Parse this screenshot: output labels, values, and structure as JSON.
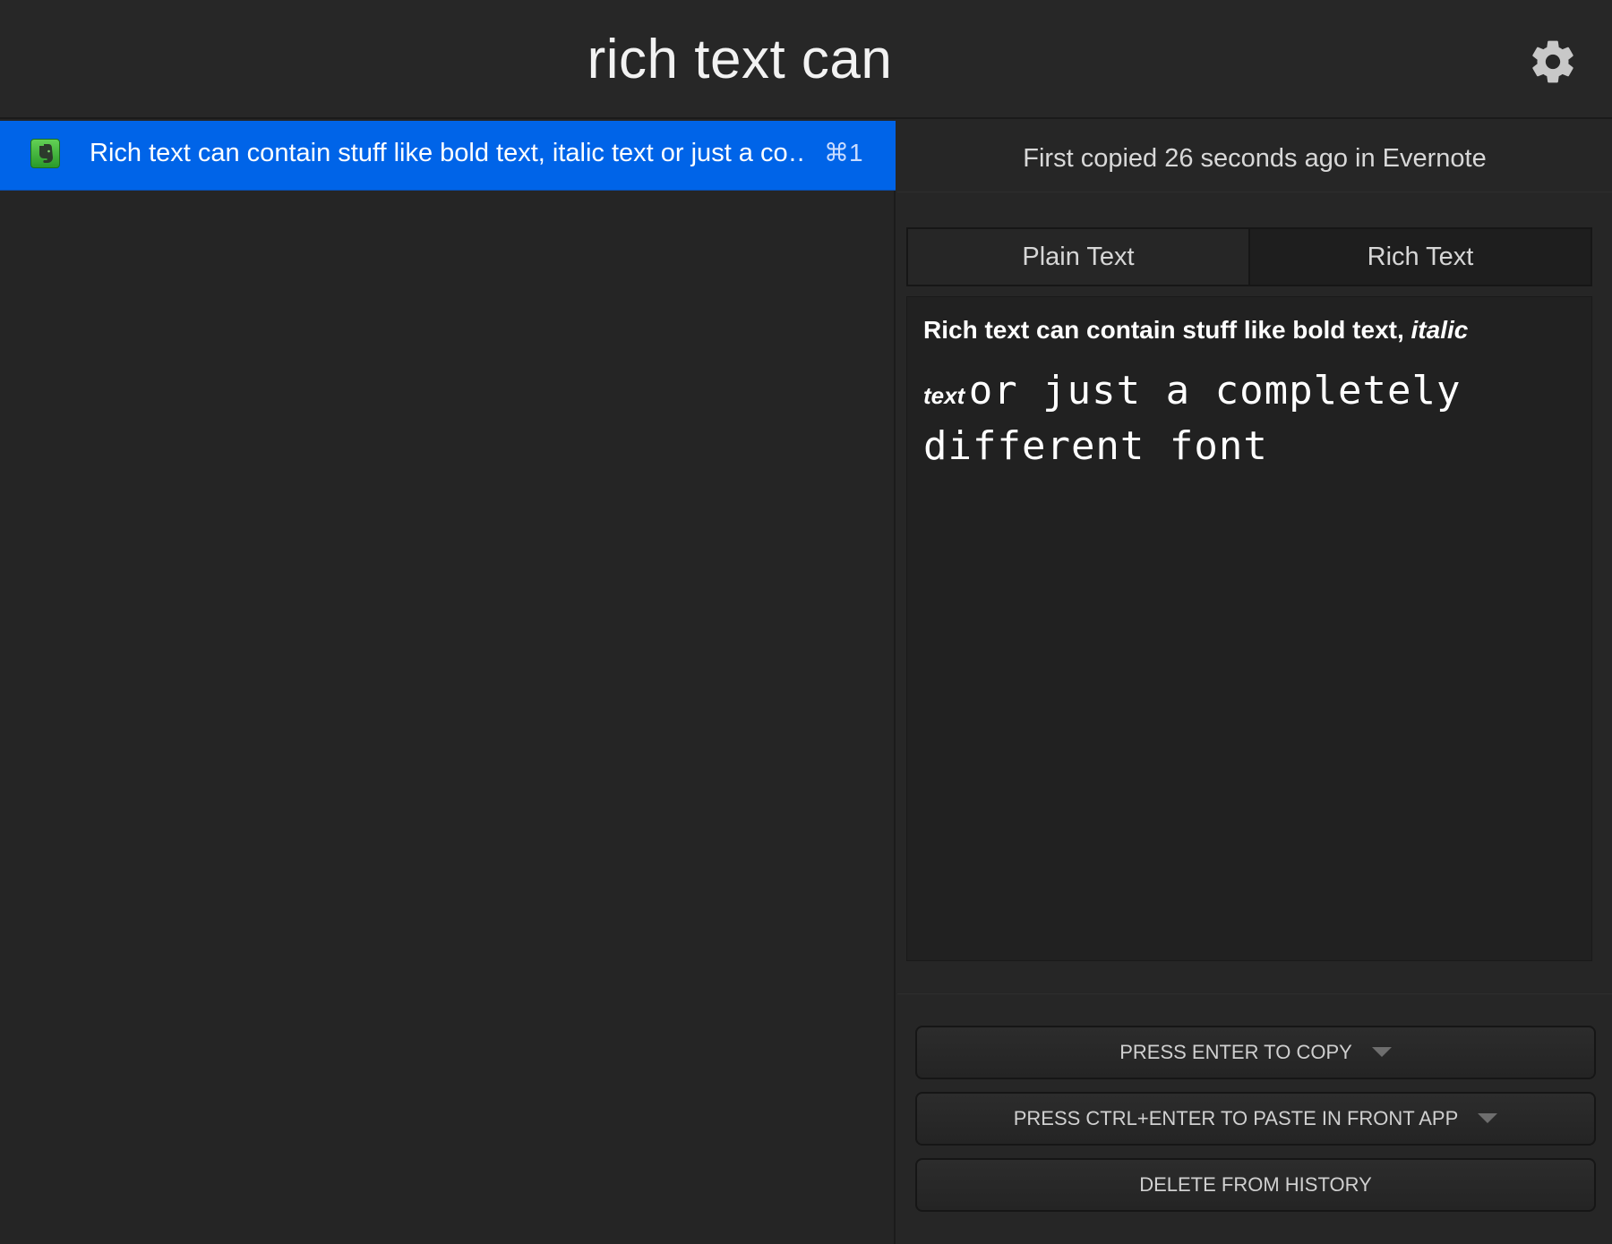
{
  "header": {
    "search_text": "rich text can",
    "settings_icon": "gear-icon"
  },
  "list": {
    "items": [
      {
        "label": "Rich text can contain stuff like bold text, italic text or just a co…",
        "shortcut": "⌘1",
        "app_icon": "evernote-icon",
        "selected": true
      }
    ]
  },
  "detail": {
    "meta": "First copied 26 seconds ago in Evernote",
    "tabs": [
      {
        "label": "Plain Text",
        "active": false
      },
      {
        "label": "Rich Text",
        "active": true
      }
    ],
    "preview": {
      "bold_part": "Rich text can contain stuff like bold text, ",
      "italic_part": "italic",
      "italic_part2": "text",
      "mono_part1": "or just a completely",
      "mono_part2": "different font"
    },
    "actions": {
      "copy": "PRESS ENTER TO COPY",
      "paste": "PRESS CTRL+ENTER TO PASTE IN FRONT APP",
      "delete": "DELETE FROM HISTORY"
    }
  },
  "colors": {
    "selection": "#0064e8",
    "background": "#262626",
    "text": "#ffffff"
  }
}
